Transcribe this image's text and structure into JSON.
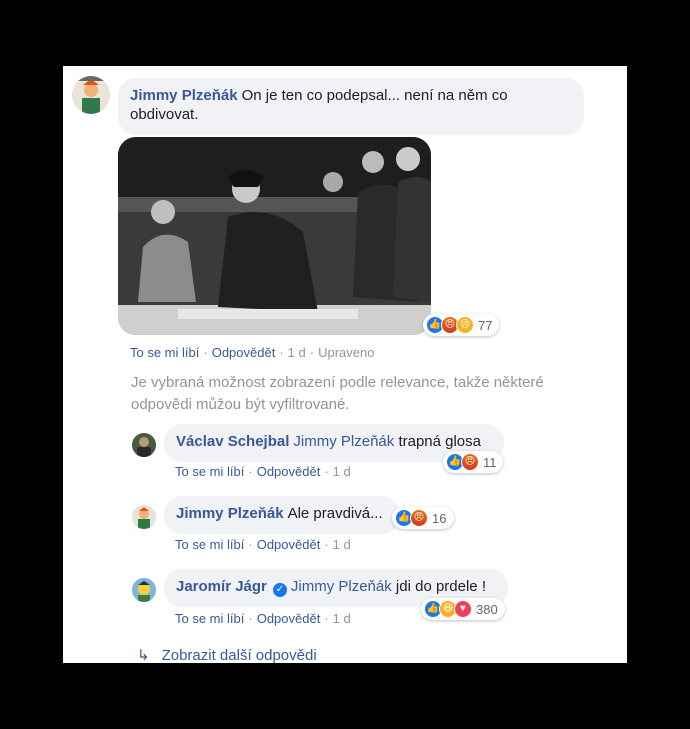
{
  "comment": {
    "author": "Jimmy Plzeňák",
    "text": "On je ten co podepsal... není na něm co obdivovat.",
    "reactions_count": "77",
    "actions": {
      "like": "To se mi líbí",
      "reply": "Odpovědět",
      "time": "1 d",
      "edited": "Upraveno"
    }
  },
  "filter_note": "Je vybraná možnost zobrazení podle relevance, takže některé odpovědi můžou být vyfiltrované.",
  "replies": [
    {
      "author": "Václav Schejbal",
      "mention": "Jimmy Plzeňák",
      "text": "trapná glosa",
      "reactions_count": "11",
      "actions": {
        "like": "To se mi líbí",
        "reply": "Odpovědět",
        "time": "1 d"
      }
    },
    {
      "author": "Jimmy Plzeňák",
      "text": "Ale pravdivá...",
      "reactions_count": "16",
      "actions": {
        "like": "To se mi líbí",
        "reply": "Odpovědět",
        "time": "1 d"
      }
    },
    {
      "author": "Jaromír Jágr",
      "mention": "Jimmy Plzeňák",
      "text": "jdi do prdele !",
      "reactions_count": "380",
      "actions": {
        "like": "To se mi líbí",
        "reply": "Odpovědět",
        "time": "1 d"
      }
    }
  ],
  "more_replies": "Zobrazit další odpovědi",
  "icons": {
    "like": "like-reaction-icon",
    "angry": "angry-reaction-icon",
    "sad": "sad-reaction-icon",
    "haha": "haha-reaction-icon",
    "love": "love-reaction-icon",
    "verified": "verified-badge-icon",
    "reply_arrow": "reply-arrow-icon"
  },
  "colors": {
    "link": "#385898",
    "bubble": "#f0f2f5",
    "muted": "#90949c",
    "like": "#1877f2"
  }
}
